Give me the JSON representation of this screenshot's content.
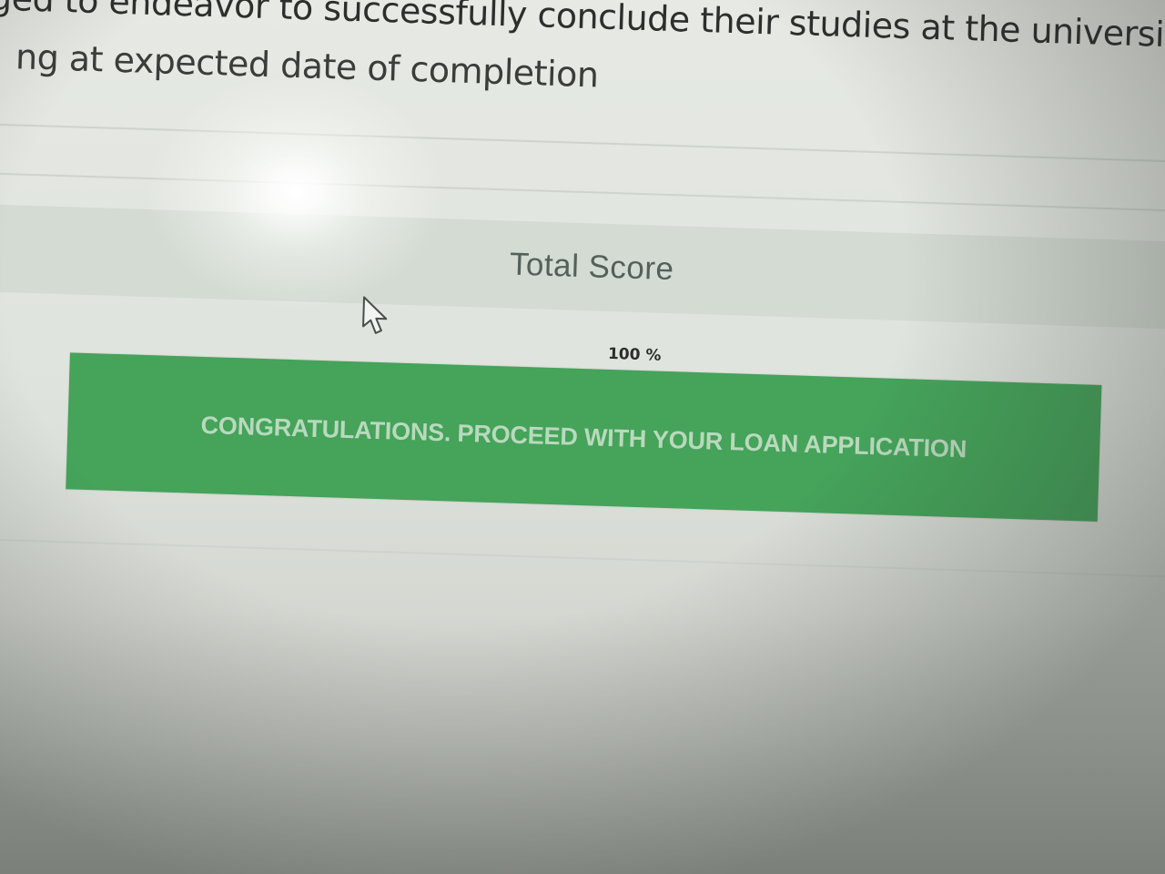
{
  "intro": {
    "line1": "ged to endeavor to successfully conclude their studies at the university. F",
    "line2": "ng at expected date of completion"
  },
  "score": {
    "title": "Total Score",
    "percent": "100 %"
  },
  "result": {
    "message": "CONGRATULATIONS. PROCEED WITH YOUR LOAN APPLICATION",
    "color": "#45a35a"
  },
  "cursor": {
    "icon": "mouse-pointer-icon"
  }
}
